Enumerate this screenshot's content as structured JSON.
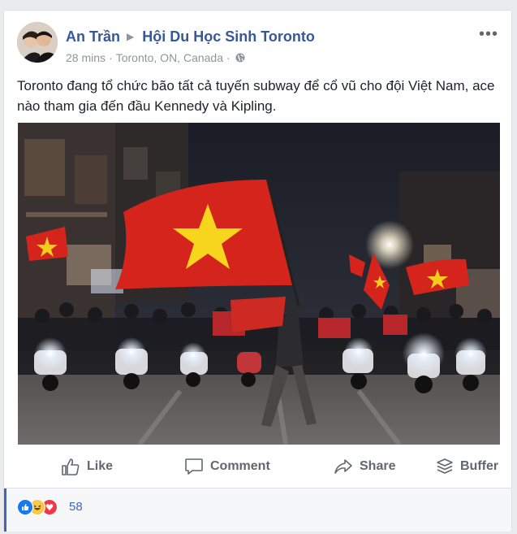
{
  "post": {
    "author": "An Trần",
    "group": "Hội Du Học Sinh Toronto",
    "time": "28 mins",
    "location": "Toronto, ON, Canada",
    "separator": "·",
    "text": "Toronto đang tổ chức bão tất cả tuyến subway để cổ vũ cho đội Việt Nam, ace nào tham gia đến đầu Kennedy và Kipling.",
    "photo_subject": "street-crowd-with-vietnam-flags"
  },
  "actions": {
    "like_label": "Like",
    "comment_label": "Comment",
    "share_label": "Share",
    "buffer_label": "Buffer"
  },
  "reactions": {
    "count": "58",
    "types": [
      "like",
      "haha",
      "love"
    ]
  },
  "colors": {
    "link": "#365899",
    "meta": "#90949c",
    "action": "#606770",
    "accent": "#4267b2",
    "flag_red": "#da251d",
    "flag_star": "#ffcd00"
  },
  "icons": {
    "privacy": "globe-icon",
    "more": "more-options-icon",
    "like": "thumbs-up-icon",
    "comment": "speech-bubble-icon",
    "share": "share-arrow-icon",
    "buffer": "stack-layers-icon"
  }
}
